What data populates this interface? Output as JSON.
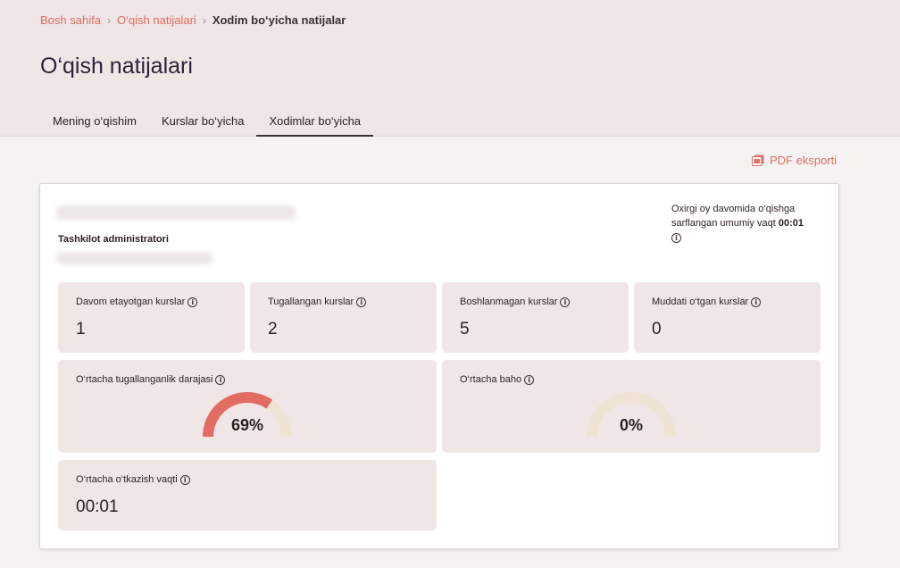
{
  "breadcrumb": {
    "home": "Bosh sahifa",
    "section": "O‘qish natijalari",
    "current": "Xodim bo‘yicha natijalar"
  },
  "page": {
    "title": "O‘qish natijalari"
  },
  "tabs": [
    {
      "label": "Mening o‘qishim"
    },
    {
      "label": "Kurslar bo‘yicha"
    },
    {
      "label": "Xodimlar bo‘yicha",
      "active": true
    }
  ],
  "export": {
    "label": "PDF eksporti"
  },
  "profile": {
    "role": "Tashkilot administratori",
    "time_text": "Oxirgi oy davomida o‘qishga sarflangan umumiy vaqt",
    "time_value": "00:01"
  },
  "stats": {
    "in_progress": {
      "label": "Davom etayotgan kurslar",
      "value": "1"
    },
    "completed": {
      "label": "Tugallangan kurslar",
      "value": "2"
    },
    "not_started": {
      "label": "Boshlanmagan kurslar",
      "value": "5"
    },
    "overdue": {
      "label": "Muddati o‘tgan kurslar",
      "value": "0"
    },
    "avg_completion": {
      "label": "O‘rtacha tugallanganlik darajasi",
      "value": "69%",
      "fraction": 0.69
    },
    "avg_grade": {
      "label": "O‘rtacha baho",
      "value": "0%",
      "fraction": 0
    },
    "avg_time": {
      "label": "O‘rtacha o‘tkazish vaqti",
      "value": "00:01"
    }
  },
  "colors": {
    "accent": "#e26b62",
    "gauge_track": "#efe3d3",
    "card_bg": "#f0e6e5"
  }
}
